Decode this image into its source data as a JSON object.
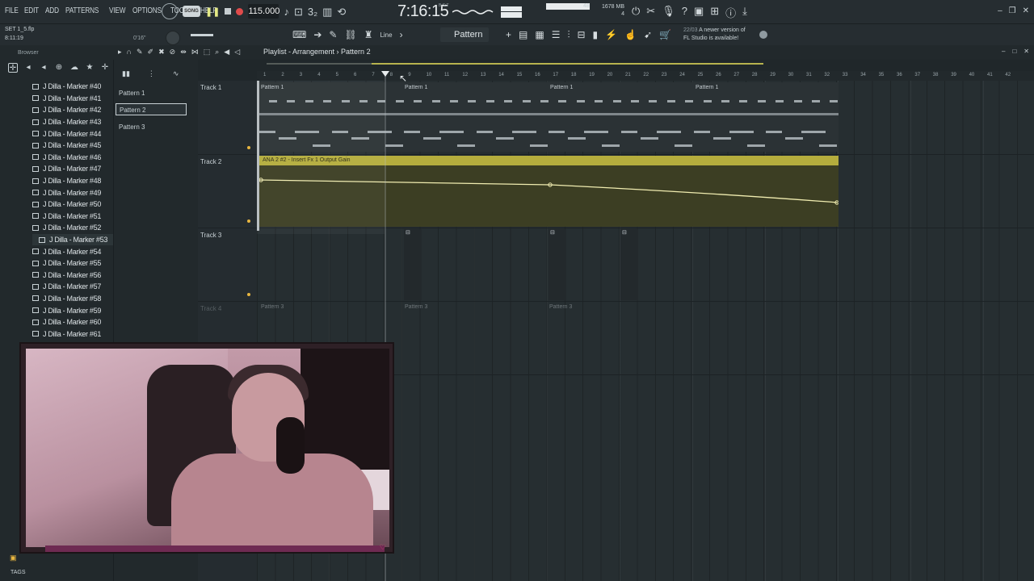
{
  "menu": [
    "FILE",
    "EDIT",
    "ADD",
    "PATTERNS",
    "VIEW",
    "OPTIONS",
    "TOOLS",
    "HELP"
  ],
  "transport": {
    "song_label": "SONG",
    "tempo": "115.000",
    "clock": "7:16:15",
    "clock_sub": "B:S:T",
    "cpu_number": "48",
    "mem_line1": "1678 MB",
    "mem_line2": "4"
  },
  "project": {
    "filename": "SET 1_5.flp",
    "time": "8:11:19",
    "small_time": "0'16\""
  },
  "toolbar2": {
    "snap": "Line",
    "pattern": "Pattern 2"
  },
  "news": {
    "date": "22/03",
    "line1": "A newer version of",
    "line2": "FL Studio is available!"
  },
  "browser": {
    "title": "Browser",
    "items": [
      "J Dilla - Marker #40",
      "J Dilla - Marker #41",
      "J Dilla - Marker #42",
      "J Dilla - Marker #43",
      "J Dilla - Marker #44",
      "J Dilla - Marker #45",
      "J Dilla - Marker #46",
      "J Dilla - Marker #47",
      "J Dilla - Marker #48",
      "J Dilla - Marker #49",
      "J Dilla - Marker #50",
      "J Dilla - Marker #51",
      "J Dilla - Marker #52",
      "J Dilla - Marker #53",
      "J Dilla - Marker #54",
      "J Dilla - Marker #55",
      "J Dilla - Marker #56",
      "J Dilla - Marker #57",
      "J Dilla - Marker #58",
      "J Dilla - Marker #59",
      "J Dilla - Marker #60",
      "J Dilla - Marker #61"
    ],
    "selected_index": 13,
    "tags": "TAGS"
  },
  "patterns": [
    "Pattern 1",
    "Pattern 2",
    "Pattern 3"
  ],
  "playlist": {
    "title": "Playlist - Arrangement",
    "pattern": "Pattern 2",
    "ruler": [
      "1",
      "2",
      "3",
      "4",
      "5",
      "6",
      "7",
      "8",
      "9",
      "10",
      "11",
      "12",
      "13",
      "14",
      "15",
      "16",
      "17",
      "18",
      "19",
      "20",
      "21",
      "22",
      "23",
      "24",
      "25",
      "26",
      "27",
      "28",
      "29",
      "30",
      "31",
      "32",
      "33",
      "34",
      "35",
      "36",
      "37",
      "38",
      "39",
      "40",
      "41",
      "42"
    ],
    "tracks": [
      "Track 1",
      "Track 2",
      "Track 3",
      "Track 4"
    ],
    "track1_clips": [
      "Pattern 1",
      "Pattern 1",
      "Pattern 1",
      "Pattern 1"
    ],
    "automation_label": "ANA 2 #2 - Insert Fx 1 Output Gain",
    "track4_clips": [
      "Pattern 3",
      "Pattern 3",
      "Pattern 3"
    ]
  },
  "colors": {
    "accent": "#e8b640",
    "automation": "#b5ad3d",
    "record": "#e04b4b"
  }
}
